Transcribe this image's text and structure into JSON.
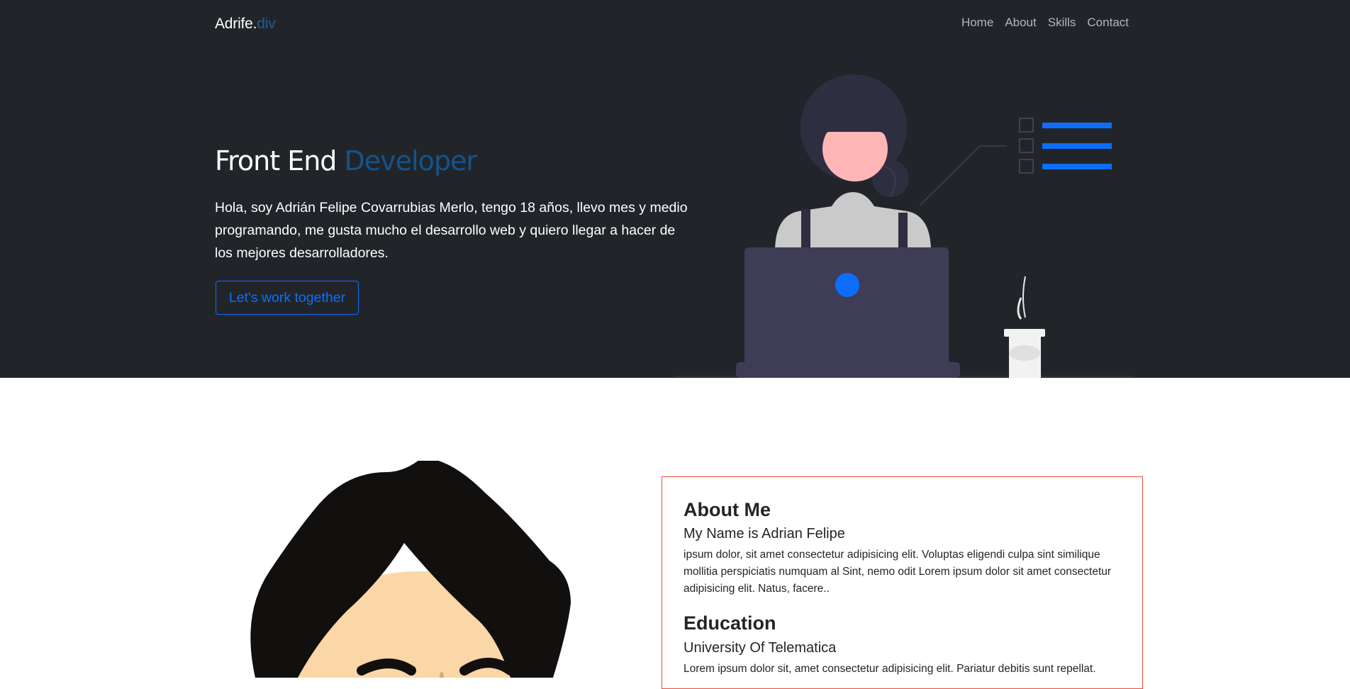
{
  "nav": {
    "brand": "Adrife.",
    "brand_suffix": "div",
    "links": [
      "Home",
      "About",
      "Skills",
      "Contact"
    ]
  },
  "hero": {
    "title": "Front End",
    "title_accent": "Developer",
    "description": "Hola, soy Adrián Felipe Covarrubias Merlo, tengo 18 años, llevo mes y medio programando, me gusta mucho el desarrollo web y quiero llegar a hacer de los mejores desarrolladores.",
    "cta_label": "Let's work together"
  },
  "about": {
    "heading": "About Me",
    "name": "My Name is Adrian Felipe",
    "bio": "ipsum dolor, sit amet consectetur adipisicing elit. Voluptas eligendi culpa sint similique mollitia perspiciatis numquam al Sint, nemo odit Lorem ipsum dolor sit amet consectetur adipisicing elit. Natus, facere..",
    "education_heading": "Education",
    "school": "University Of Telematica",
    "education_text": "Lorem ipsum dolor sit, amet consectetur adipisicing elit. Pariatur debitis sunt repellat."
  },
  "colors": {
    "hero_bg": "#212529",
    "accent": "#0d6efd",
    "title_accent": "#15538a",
    "card_border": "#e74c3c"
  },
  "icons": {
    "hero_illustration": "woman-at-laptop-illustration",
    "avatar": "cartoon-avatar-illustration"
  }
}
